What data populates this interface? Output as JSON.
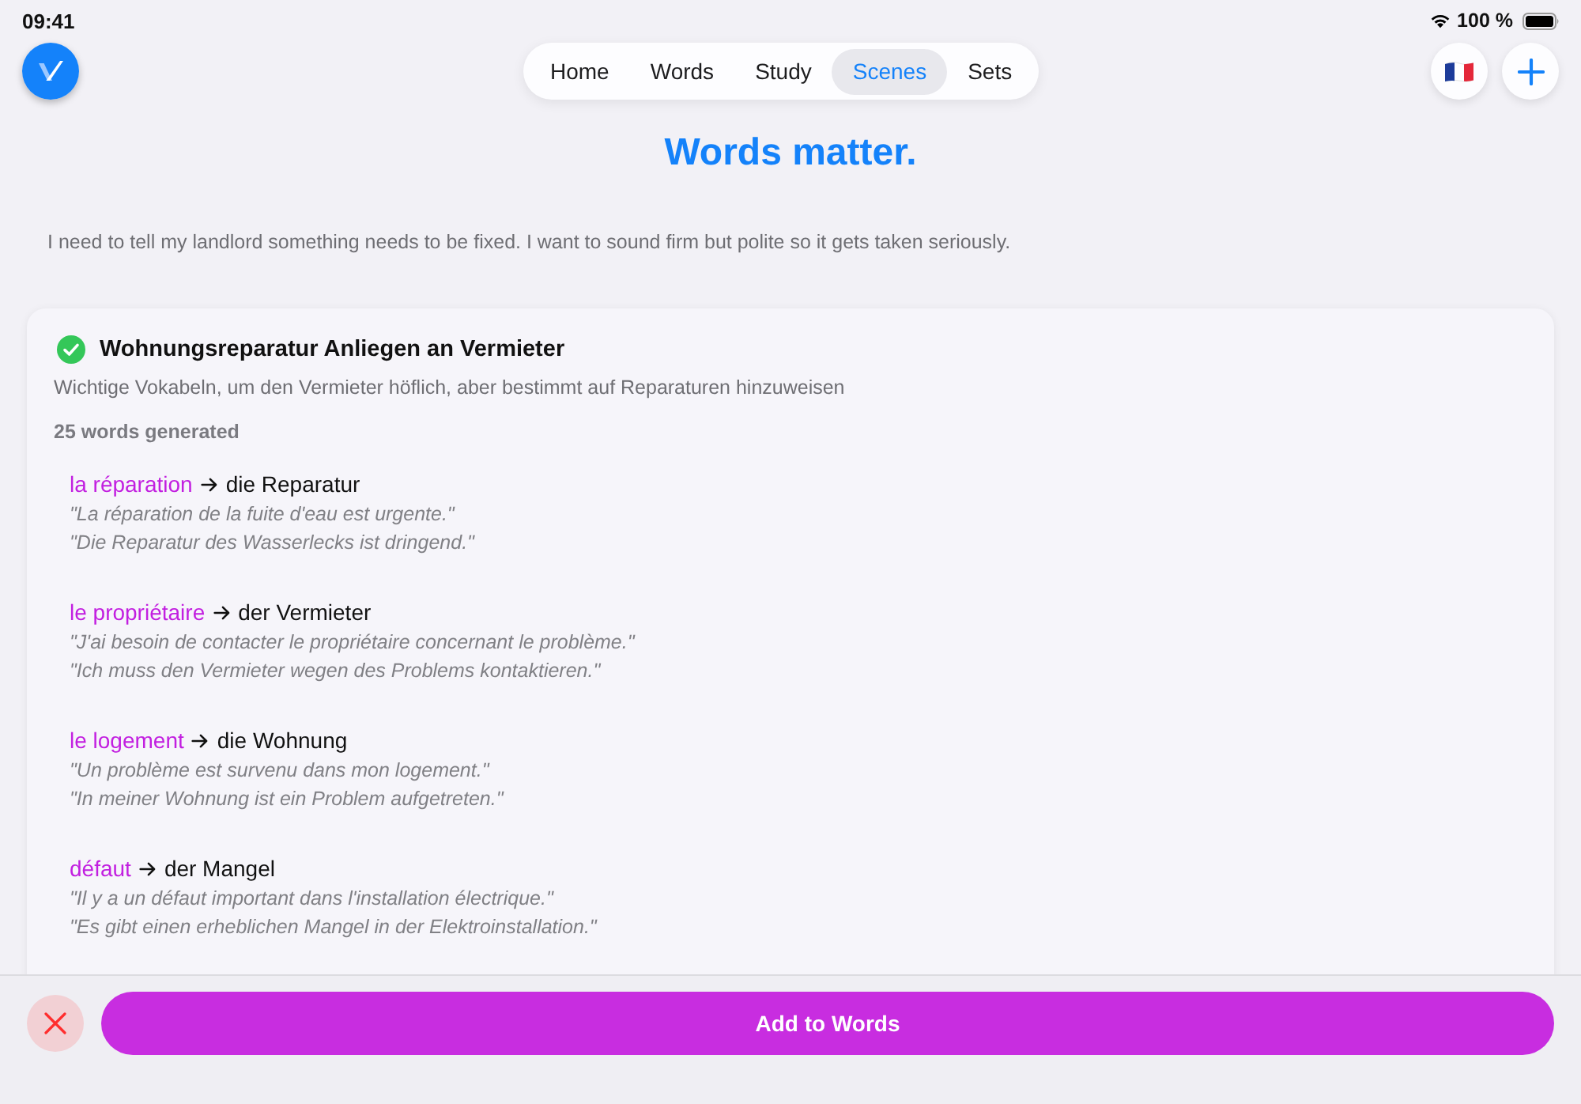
{
  "status_bar": {
    "time": "09:41",
    "battery": "100 %"
  },
  "nav": {
    "tabs": [
      {
        "label": "Home",
        "selected": false
      },
      {
        "label": "Words",
        "selected": false
      },
      {
        "label": "Study",
        "selected": false
      },
      {
        "label": "Scenes",
        "selected": true
      },
      {
        "label": "Sets",
        "selected": false
      }
    ]
  },
  "title": "Words matter.",
  "prompt": "I need to tell my landlord something needs to be fixed. I want to sound firm but polite so it gets taken seriously.",
  "scene": {
    "done": true,
    "title": "Wohnungsreparatur Anliegen an Vermieter",
    "description": "Wichtige Vokabeln, um den Vermieter höflich, aber bestimmt auf Reparaturen hinzuweisen",
    "count": "25 words generated",
    "words": [
      {
        "term": "la réparation",
        "translation": "die Reparatur",
        "example": "\"La réparation de la fuite d'eau est urgente.\"",
        "example_translation": "\"Die Reparatur des Wasserlecks ist dringend.\""
      },
      {
        "term": "le propriétaire",
        "translation": "der Vermieter",
        "example": "\"J'ai besoin de contacter le propriétaire concernant le problème.\"",
        "example_translation": "\"Ich muss den Vermieter wegen des Problems kontaktieren.\""
      },
      {
        "term": "le logement",
        "translation": "die Wohnung",
        "example": "\"Un problème est survenu dans mon logement.\"",
        "example_translation": "\"In meiner Wohnung ist ein Problem aufgetreten.\""
      },
      {
        "term": "défaut",
        "translation": "der Mangel",
        "example": "\"Il y a un défaut important dans l'installation électrique.\"",
        "example_translation": "\"Es gibt einen erheblichen Mangel in der Elektroinstallation.\""
      }
    ]
  },
  "actions": {
    "add_button": "Add to Words"
  }
}
